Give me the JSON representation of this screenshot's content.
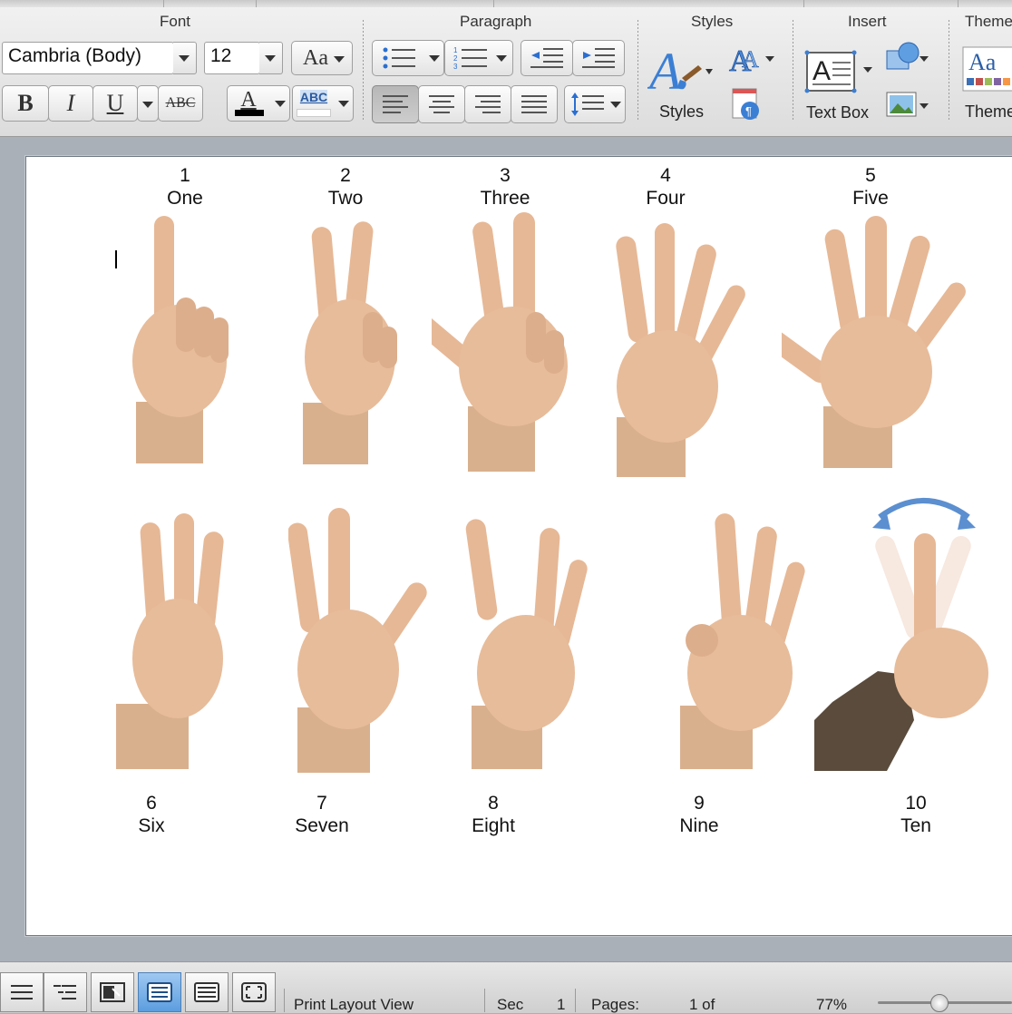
{
  "ribbon": {
    "groups": {
      "font": "Font",
      "paragraph": "Paragraph",
      "styles": "Styles",
      "insert": "Insert",
      "themes": "Theme"
    },
    "font_name": "Cambria (Body)",
    "font_size": "12",
    "buttons": {
      "bold": "B",
      "italic": "I",
      "underline": "U",
      "strikethrough": "ABC",
      "change_case": "Aa",
      "font_color": "A",
      "highlight": "ABC"
    },
    "styles_label": "Styles",
    "text_box_label": "Text Box",
    "themes_label": "Theme",
    "themes_preview": "Aa"
  },
  "document": {
    "numbers": [
      {
        "digit": "1",
        "word": "One"
      },
      {
        "digit": "2",
        "word": "Two"
      },
      {
        "digit": "3",
        "word": "Three"
      },
      {
        "digit": "4",
        "word": "Four"
      },
      {
        "digit": "5",
        "word": "Five"
      },
      {
        "digit": "6",
        "word": "Six"
      },
      {
        "digit": "7",
        "word": "Seven"
      },
      {
        "digit": "8",
        "word": "Eight"
      },
      {
        "digit": "9",
        "word": "Nine"
      },
      {
        "digit": "10",
        "word": "Ten"
      }
    ],
    "skin_color": "#e9bfa0",
    "sleeve_color": "#5a4b3c",
    "arrow_color": "#5b8fd0"
  },
  "statusbar": {
    "view": "Print Layout View",
    "section_label": "Sec",
    "section_value": "1",
    "pages_label": "Pages:",
    "pages_value": "1 of",
    "zoom": "77%"
  }
}
